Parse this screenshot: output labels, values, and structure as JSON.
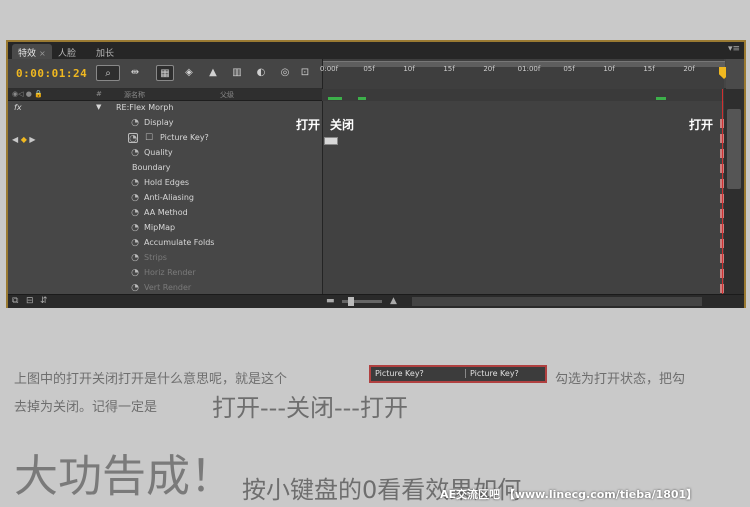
{
  "tabs": [
    {
      "label": "特效",
      "close": "×"
    },
    {
      "label": "人脸",
      "close": ""
    },
    {
      "label": "加长",
      "close": ""
    }
  ],
  "panel_menu": "▾≡",
  "timecode": "0:00:01:24",
  "ruler_labels": [
    "0:00f",
    "05f",
    "10f",
    "15f",
    "20f",
    "01:00f",
    "05f",
    "10f",
    "15f",
    "20f"
  ],
  "headers": {
    "switches": "◉◁ ● 🔒",
    "num": "#",
    "source": "源名称",
    "parent": "父级"
  },
  "rows": [
    {
      "name": "RE:Flex Morph",
      "stopwatch": false,
      "dim": false,
      "indent": 108,
      "expand": "▼",
      "fx": "fx"
    },
    {
      "name": "Display",
      "stopwatch": true,
      "dim": false,
      "indent": 136
    },
    {
      "name": "Picture Key?",
      "stopwatch": true,
      "dim": false,
      "indent": 152,
      "checkbox": true
    },
    {
      "name": "Quality",
      "stopwatch": true,
      "dim": false,
      "indent": 136
    },
    {
      "name": "Boundary",
      "stopwatch": false,
      "dim": false,
      "indent": 124
    },
    {
      "name": "Hold Edges",
      "stopwatch": true,
      "dim": false,
      "indent": 136
    },
    {
      "name": "Anti-Aliasing",
      "stopwatch": true,
      "dim": false,
      "indent": 136
    },
    {
      "name": "AA Method",
      "stopwatch": true,
      "dim": false,
      "indent": 136
    },
    {
      "name": "MipMap",
      "stopwatch": true,
      "dim": false,
      "indent": 136
    },
    {
      "name": "Accumulate Folds",
      "stopwatch": true,
      "dim": false,
      "indent": 136
    },
    {
      "name": "Strips",
      "stopwatch": true,
      "dim": true,
      "indent": 136
    },
    {
      "name": "Horiz Render",
      "stopwatch": true,
      "dim": true,
      "indent": 136
    },
    {
      "name": "Vert Render",
      "stopwatch": true,
      "dim": true,
      "indent": 136
    }
  ],
  "annotations": {
    "open_left": "打开",
    "close": "关闭",
    "open_right": "打开"
  },
  "kf_nav": {
    "prev": "◀",
    "diamond": "◆",
    "next": "▶"
  },
  "article": {
    "line1": "上图中的打开关闭打开是什么意思呢，就是这个",
    "inline_item1": "Picture Key?",
    "inline_item2": "Picture Key?",
    "line1b": "勾选为打开状态，把勾",
    "line2": "去掉为关闭。记得一定是",
    "line2_big": "打开---关闭---打开",
    "line3_big": "大功告成！",
    "line3_rest": "按小键盘的0看看效果如何",
    "watermark": "AE交流区吧 【www.linecg.com/tieba/1801】"
  },
  "colors": {
    "accent": "#f0b820",
    "cti": "#d03030",
    "border": "#9a7a32",
    "keyframe_green": "#3cb04a"
  }
}
